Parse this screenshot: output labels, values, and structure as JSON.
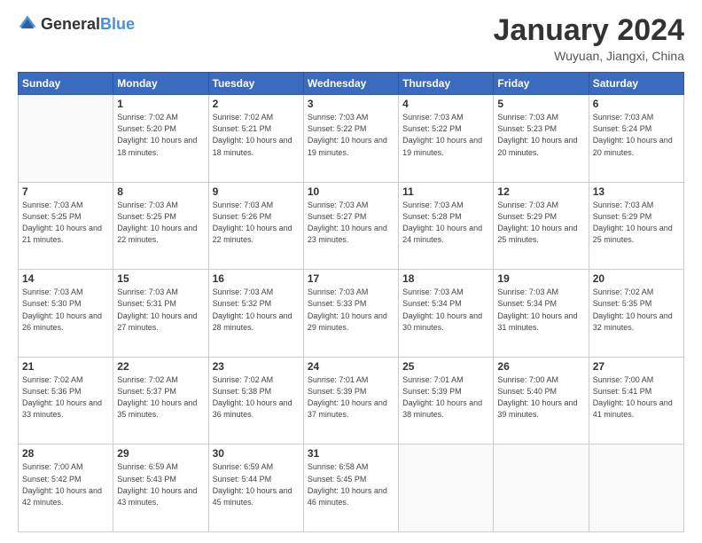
{
  "header": {
    "logo": {
      "general": "General",
      "blue": "Blue"
    },
    "title": "January 2024",
    "location": "Wuyuan, Jiangxi, China"
  },
  "calendar": {
    "weekdays": [
      "Sunday",
      "Monday",
      "Tuesday",
      "Wednesday",
      "Thursday",
      "Friday",
      "Saturday"
    ],
    "weeks": [
      [
        {
          "day": "",
          "sunrise": "",
          "sunset": "",
          "daylight": ""
        },
        {
          "day": "1",
          "sunrise": "Sunrise: 7:02 AM",
          "sunset": "Sunset: 5:20 PM",
          "daylight": "Daylight: 10 hours and 18 minutes."
        },
        {
          "day": "2",
          "sunrise": "Sunrise: 7:02 AM",
          "sunset": "Sunset: 5:21 PM",
          "daylight": "Daylight: 10 hours and 18 minutes."
        },
        {
          "day": "3",
          "sunrise": "Sunrise: 7:03 AM",
          "sunset": "Sunset: 5:22 PM",
          "daylight": "Daylight: 10 hours and 19 minutes."
        },
        {
          "day": "4",
          "sunrise": "Sunrise: 7:03 AM",
          "sunset": "Sunset: 5:22 PM",
          "daylight": "Daylight: 10 hours and 19 minutes."
        },
        {
          "day": "5",
          "sunrise": "Sunrise: 7:03 AM",
          "sunset": "Sunset: 5:23 PM",
          "daylight": "Daylight: 10 hours and 20 minutes."
        },
        {
          "day": "6",
          "sunrise": "Sunrise: 7:03 AM",
          "sunset": "Sunset: 5:24 PM",
          "daylight": "Daylight: 10 hours and 20 minutes."
        }
      ],
      [
        {
          "day": "7",
          "sunrise": "Sunrise: 7:03 AM",
          "sunset": "Sunset: 5:25 PM",
          "daylight": "Daylight: 10 hours and 21 minutes."
        },
        {
          "day": "8",
          "sunrise": "Sunrise: 7:03 AM",
          "sunset": "Sunset: 5:25 PM",
          "daylight": "Daylight: 10 hours and 22 minutes."
        },
        {
          "day": "9",
          "sunrise": "Sunrise: 7:03 AM",
          "sunset": "Sunset: 5:26 PM",
          "daylight": "Daylight: 10 hours and 22 minutes."
        },
        {
          "day": "10",
          "sunrise": "Sunrise: 7:03 AM",
          "sunset": "Sunset: 5:27 PM",
          "daylight": "Daylight: 10 hours and 23 minutes."
        },
        {
          "day": "11",
          "sunrise": "Sunrise: 7:03 AM",
          "sunset": "Sunset: 5:28 PM",
          "daylight": "Daylight: 10 hours and 24 minutes."
        },
        {
          "day": "12",
          "sunrise": "Sunrise: 7:03 AM",
          "sunset": "Sunset: 5:29 PM",
          "daylight": "Daylight: 10 hours and 25 minutes."
        },
        {
          "day": "13",
          "sunrise": "Sunrise: 7:03 AM",
          "sunset": "Sunset: 5:29 PM",
          "daylight": "Daylight: 10 hours and 25 minutes."
        }
      ],
      [
        {
          "day": "14",
          "sunrise": "Sunrise: 7:03 AM",
          "sunset": "Sunset: 5:30 PM",
          "daylight": "Daylight: 10 hours and 26 minutes."
        },
        {
          "day": "15",
          "sunrise": "Sunrise: 7:03 AM",
          "sunset": "Sunset: 5:31 PM",
          "daylight": "Daylight: 10 hours and 27 minutes."
        },
        {
          "day": "16",
          "sunrise": "Sunrise: 7:03 AM",
          "sunset": "Sunset: 5:32 PM",
          "daylight": "Daylight: 10 hours and 28 minutes."
        },
        {
          "day": "17",
          "sunrise": "Sunrise: 7:03 AM",
          "sunset": "Sunset: 5:33 PM",
          "daylight": "Daylight: 10 hours and 29 minutes."
        },
        {
          "day": "18",
          "sunrise": "Sunrise: 7:03 AM",
          "sunset": "Sunset: 5:34 PM",
          "daylight": "Daylight: 10 hours and 30 minutes."
        },
        {
          "day": "19",
          "sunrise": "Sunrise: 7:03 AM",
          "sunset": "Sunset: 5:34 PM",
          "daylight": "Daylight: 10 hours and 31 minutes."
        },
        {
          "day": "20",
          "sunrise": "Sunrise: 7:02 AM",
          "sunset": "Sunset: 5:35 PM",
          "daylight": "Daylight: 10 hours and 32 minutes."
        }
      ],
      [
        {
          "day": "21",
          "sunrise": "Sunrise: 7:02 AM",
          "sunset": "Sunset: 5:36 PM",
          "daylight": "Daylight: 10 hours and 33 minutes."
        },
        {
          "day": "22",
          "sunrise": "Sunrise: 7:02 AM",
          "sunset": "Sunset: 5:37 PM",
          "daylight": "Daylight: 10 hours and 35 minutes."
        },
        {
          "day": "23",
          "sunrise": "Sunrise: 7:02 AM",
          "sunset": "Sunset: 5:38 PM",
          "daylight": "Daylight: 10 hours and 36 minutes."
        },
        {
          "day": "24",
          "sunrise": "Sunrise: 7:01 AM",
          "sunset": "Sunset: 5:39 PM",
          "daylight": "Daylight: 10 hours and 37 minutes."
        },
        {
          "day": "25",
          "sunrise": "Sunrise: 7:01 AM",
          "sunset": "Sunset: 5:39 PM",
          "daylight": "Daylight: 10 hours and 38 minutes."
        },
        {
          "day": "26",
          "sunrise": "Sunrise: 7:00 AM",
          "sunset": "Sunset: 5:40 PM",
          "daylight": "Daylight: 10 hours and 39 minutes."
        },
        {
          "day": "27",
          "sunrise": "Sunrise: 7:00 AM",
          "sunset": "Sunset: 5:41 PM",
          "daylight": "Daylight: 10 hours and 41 minutes."
        }
      ],
      [
        {
          "day": "28",
          "sunrise": "Sunrise: 7:00 AM",
          "sunset": "Sunset: 5:42 PM",
          "daylight": "Daylight: 10 hours and 42 minutes."
        },
        {
          "day": "29",
          "sunrise": "Sunrise: 6:59 AM",
          "sunset": "Sunset: 5:43 PM",
          "daylight": "Daylight: 10 hours and 43 minutes."
        },
        {
          "day": "30",
          "sunrise": "Sunrise: 6:59 AM",
          "sunset": "Sunset: 5:44 PM",
          "daylight": "Daylight: 10 hours and 45 minutes."
        },
        {
          "day": "31",
          "sunrise": "Sunrise: 6:58 AM",
          "sunset": "Sunset: 5:45 PM",
          "daylight": "Daylight: 10 hours and 46 minutes."
        },
        {
          "day": "",
          "sunrise": "",
          "sunset": "",
          "daylight": ""
        },
        {
          "day": "",
          "sunrise": "",
          "sunset": "",
          "daylight": ""
        },
        {
          "day": "",
          "sunrise": "",
          "sunset": "",
          "daylight": ""
        }
      ]
    ]
  }
}
